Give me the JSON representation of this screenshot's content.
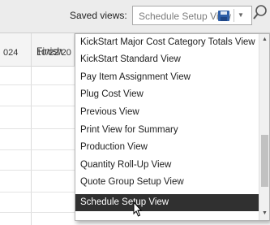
{
  "toolbar": {
    "saved_views_label": "Saved views:",
    "saved_views_value": "Schedule Setup View"
  },
  "grid": {
    "columns": [
      "",
      "Finish"
    ],
    "row": [
      "024",
      "10/22/20"
    ]
  },
  "dropdown": {
    "items": [
      "KickStart Major Cost Category Totals View",
      "KickStart Standard View",
      "Pay Item Assignment View",
      "Plug Cost View",
      "Previous View",
      "Print View for Summary",
      "Production View",
      "Quantity Roll-Up View",
      "Quote Group Setup View",
      "Schedule Setup View"
    ],
    "selected_index": 9
  },
  "icons": {
    "save": "save-icon",
    "dropdown": "chevron-down-icon",
    "search": "search-icon",
    "cursor": "mouse-pointer-icon"
  },
  "colors": {
    "selected_bg": "#303030",
    "save_icon": "#2e5fa8"
  }
}
